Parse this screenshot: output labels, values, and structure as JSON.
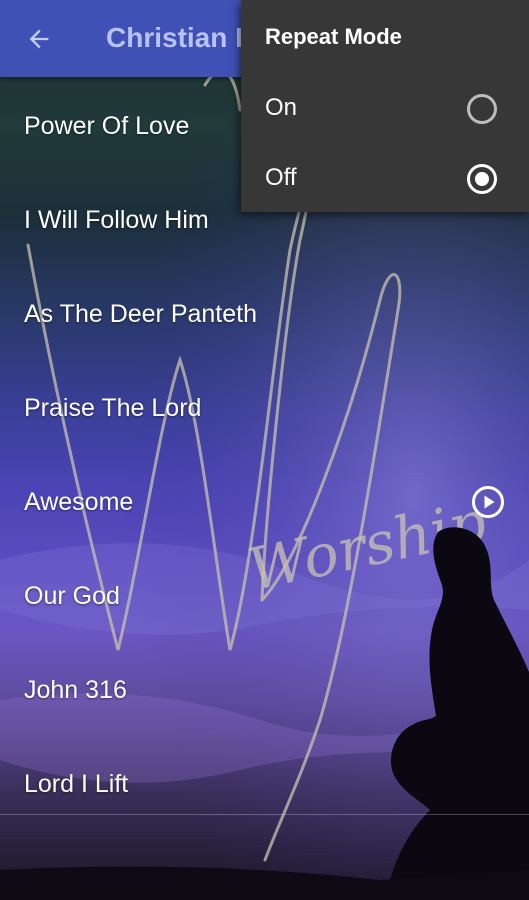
{
  "toolbar": {
    "title": "Christian P",
    "back_icon": "arrow-left-icon",
    "background": "#3f51b5"
  },
  "songs": [
    {
      "title": "Power Of Love"
    },
    {
      "title": "I Will Follow Him"
    },
    {
      "title": "As The Deer Panteth"
    },
    {
      "title": "Praise The Lord"
    },
    {
      "title": "Awesome",
      "playing_icon": "play-circle-icon"
    },
    {
      "title": "Our God"
    },
    {
      "title": "John 316"
    },
    {
      "title": "Lord I Lift"
    }
  ],
  "background_art": {
    "word": "Worship"
  },
  "repeat_menu": {
    "title": "Repeat Mode",
    "options": [
      {
        "label": "On",
        "selected": false
      },
      {
        "label": "Off",
        "selected": true
      }
    ],
    "background": "#373737"
  }
}
